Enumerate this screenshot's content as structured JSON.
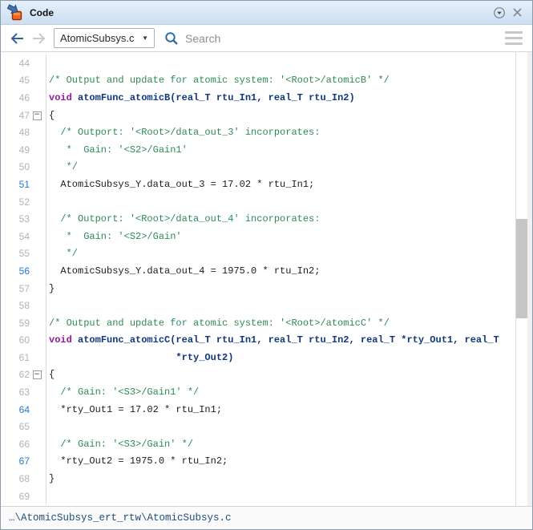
{
  "window": {
    "title": "Code"
  },
  "titlebar": {
    "dock_icon": "dock-options",
    "close_icon": "close"
  },
  "toolbar": {
    "back_label": "back",
    "forward_label": "forward",
    "file_selector_value": "AtomicSubsys.c",
    "file_selector_caret": "▼",
    "search_placeholder": "Search"
  },
  "icons": {
    "fold_collapsed_glyph": "−"
  },
  "colors": {
    "comment": "#2e8b57",
    "keyword": "#951ba0",
    "function": "#11387f",
    "line_number_link": "#2778cf",
    "titlebar_top": "#e6effb",
    "titlebar_bottom": "#cddff2",
    "scroll_thumb": "#c6c6c6"
  },
  "code": {
    "lines": [
      {
        "num": 44,
        "seg": []
      },
      {
        "num": 45,
        "seg": [
          {
            "t": "/* Output and update for atomic system: '<Root>/atomicB' */",
            "s": "cmt"
          }
        ]
      },
      {
        "num": 46,
        "seg": [
          {
            "t": "void ",
            "s": "kw"
          },
          {
            "t": "atomFunc_atomicB(real_T rtu_In1, real_T rtu_In2)",
            "s": "fn"
          }
        ]
      },
      {
        "num": 47,
        "fold": true,
        "seg": [
          {
            "t": "{",
            "s": "pln"
          }
        ]
      },
      {
        "num": 48,
        "seg": [
          {
            "t": "  /* Outport: '<Root>/data_out_3' incorporates:",
            "s": "cmt"
          }
        ]
      },
      {
        "num": 49,
        "seg": [
          {
            "t": "   *  Gain: '<S2>/Gain1'",
            "s": "cmt"
          }
        ]
      },
      {
        "num": 50,
        "seg": [
          {
            "t": "   */",
            "s": "cmt"
          }
        ]
      },
      {
        "num": 51,
        "blue": true,
        "seg": [
          {
            "t": "  AtomicSubsys_Y.data_out_3 = 17.02 * rtu_In1;",
            "s": "pln"
          }
        ]
      },
      {
        "num": 52,
        "seg": []
      },
      {
        "num": 53,
        "seg": [
          {
            "t": "  /* Outport: '<Root>/data_out_4' incorporates:",
            "s": "cmt"
          }
        ]
      },
      {
        "num": 54,
        "seg": [
          {
            "t": "   *  Gain: '<S2>/Gain'",
            "s": "cmt"
          }
        ]
      },
      {
        "num": 55,
        "seg": [
          {
            "t": "   */",
            "s": "cmt"
          }
        ]
      },
      {
        "num": 56,
        "blue": true,
        "seg": [
          {
            "t": "  AtomicSubsys_Y.data_out_4 = 1975.0 * rtu_In2;",
            "s": "pln"
          }
        ]
      },
      {
        "num": 57,
        "seg": [
          {
            "t": "}",
            "s": "pln"
          }
        ]
      },
      {
        "num": 58,
        "seg": []
      },
      {
        "num": 59,
        "seg": [
          {
            "t": "/* Output and update for atomic system: '<Root>/atomicC' */",
            "s": "cmt"
          }
        ]
      },
      {
        "num": 60,
        "seg": [
          {
            "t": "void ",
            "s": "kw"
          },
          {
            "t": "atomFunc_atomicC(real_T rtu_In1, real_T rtu_In2, real_T *rty_Out1, real_T",
            "s": "fn"
          }
        ]
      },
      {
        "num": 61,
        "seg": [
          {
            "t": "                      *rty_Out2)",
            "s": "fn"
          }
        ]
      },
      {
        "num": 62,
        "fold": true,
        "seg": [
          {
            "t": "{",
            "s": "pln"
          }
        ]
      },
      {
        "num": 63,
        "seg": [
          {
            "t": "  /* Gain: '<S3>/Gain1' */",
            "s": "cmt"
          }
        ]
      },
      {
        "num": 64,
        "blue": true,
        "seg": [
          {
            "t": "  *rty_Out1 = 17.02 * rtu_In1;",
            "s": "pln"
          }
        ]
      },
      {
        "num": 65,
        "seg": []
      },
      {
        "num": 66,
        "seg": [
          {
            "t": "  /* Gain: '<S3>/Gain' */",
            "s": "cmt"
          }
        ]
      },
      {
        "num": 67,
        "blue": true,
        "seg": [
          {
            "t": "  *rty_Out2 = 1975.0 * rtu_In2;",
            "s": "pln"
          }
        ]
      },
      {
        "num": 68,
        "seg": [
          {
            "t": "}",
            "s": "pln"
          }
        ]
      },
      {
        "num": 69,
        "seg": []
      }
    ]
  },
  "scrollbar": {
    "thumb_top_pct": 36.7,
    "thumb_height_pct": 22.0
  },
  "statusbar": {
    "path": "…\\AtomicSubsys_ert_rtw\\AtomicSubsys.c"
  }
}
